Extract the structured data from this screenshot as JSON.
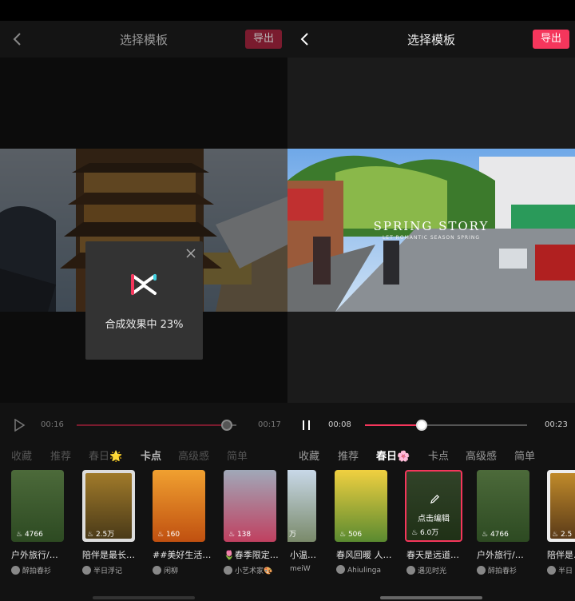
{
  "left": {
    "title": "选择模板",
    "export_label": "导出",
    "progress_modal": {
      "message": "合成效果中 23%"
    },
    "player": {
      "current_time": "00:16",
      "total_time": "00:17",
      "progress": 0.94
    },
    "tabs": [
      {
        "label": "收藏",
        "active": false
      },
      {
        "label": "推荐",
        "active": false
      },
      {
        "label": "春日🌟",
        "active": false
      },
      {
        "label": "卡点",
        "active": true
      },
      {
        "label": "高级感",
        "active": false
      },
      {
        "label": "简单",
        "active": false
      }
    ],
    "templates": [
      {
        "caption": "户外旅行/…",
        "likes": "4766",
        "author": "醉拍春衫"
      },
      {
        "caption": "陪伴是最长…",
        "likes": "2.5万",
        "author": "半日浮记"
      },
      {
        "caption": "##美好生活…",
        "likes": "160",
        "author": "闲柳"
      },
      {
        "caption": "🌷春季限定…",
        "likes": "138",
        "author": "小艺术家🎨"
      }
    ]
  },
  "right": {
    "title": "选择模板",
    "export_label": "导出",
    "preview_title": "SPRING STORY",
    "preview_subtitle": "LET ROMANTIC SEASON SPRING",
    "player": {
      "current_time": "00:08",
      "total_time": "00:23",
      "progress": 0.35
    },
    "tabs": [
      {
        "label": "收藏",
        "active": false
      },
      {
        "label": "推荐",
        "active": false
      },
      {
        "label": "春日🌸",
        "active": true
      },
      {
        "label": "卡点",
        "active": false
      },
      {
        "label": "高级感",
        "active": false
      },
      {
        "label": "简单",
        "active": false
      }
    ],
    "templates": [
      {
        "caption": "小温…",
        "likes": "万",
        "author": "meiW"
      },
      {
        "caption": "春风回暖 人…",
        "likes": "506",
        "author": "Ahiulinga"
      },
      {
        "caption": "春天是远道…",
        "likes": "6.0万",
        "author": "遇见时光",
        "selected": true,
        "edit_label": "点击编辑"
      },
      {
        "caption": "户外旅行/…",
        "likes": "4766",
        "author": "醉拍春衫"
      },
      {
        "caption": "陪伴是…",
        "likes": "2.5",
        "author": "半日"
      }
    ]
  },
  "colors": {
    "accent": "#f5365c",
    "background": "#121212"
  },
  "icons": [
    "back-arrow-icon",
    "play-icon",
    "pause-icon",
    "close-icon",
    "capcut-logo-icon",
    "flame-icon",
    "pencil-icon"
  ]
}
